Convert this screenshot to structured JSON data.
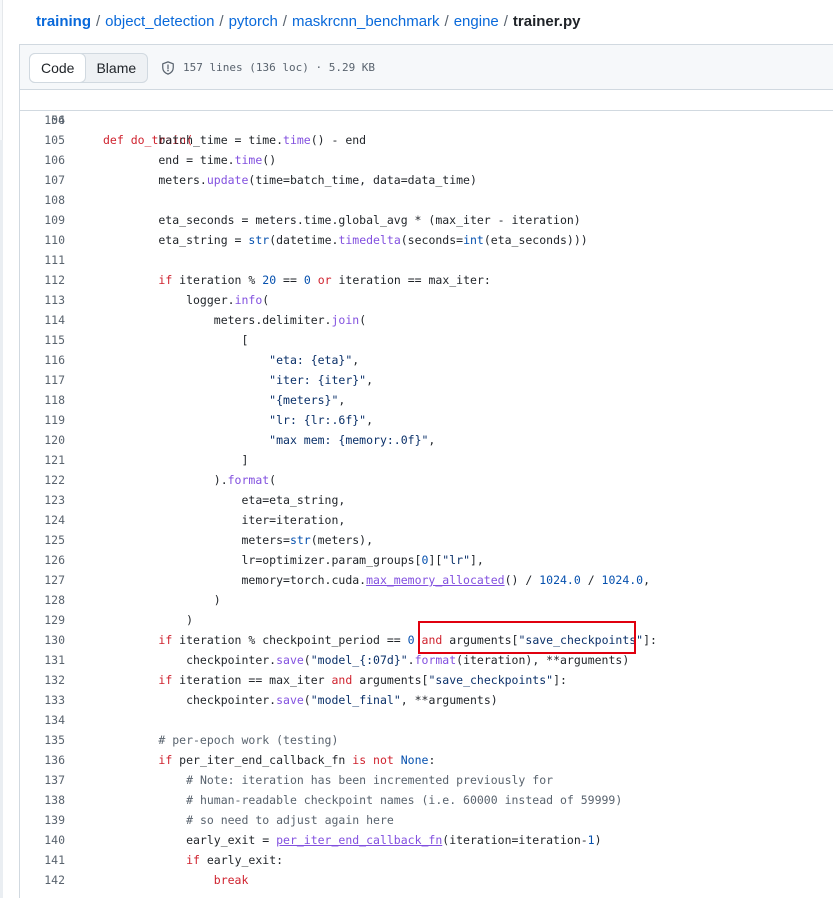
{
  "breadcrumb": {
    "parts": [
      "training",
      "object_detection",
      "pytorch",
      "maskrcnn_benchmark",
      "engine"
    ],
    "current": "trainer.py",
    "separator": "/"
  },
  "file_header": {
    "code_tab": "Code",
    "blame_tab": "Blame",
    "info": "157 lines (136 loc) · 5.29 KB"
  },
  "sticky": {
    "number": "56",
    "code": "def do_train("
  },
  "code_lines": [
    {
      "n": "104",
      "t": []
    },
    {
      "n": "105",
      "t": [
        [
          "        batch_time = time.",
          ""
        ],
        [
          "time",
          "fn"
        ],
        [
          "() - end",
          ""
        ]
      ]
    },
    {
      "n": "106",
      "t": [
        [
          "        end = time.",
          ""
        ],
        [
          "time",
          "fn"
        ],
        [
          "()",
          ""
        ]
      ]
    },
    {
      "n": "107",
      "t": [
        [
          "        meters.",
          ""
        ],
        [
          "update",
          "fn"
        ],
        [
          "(time=batch_time, data=data_time)",
          ""
        ]
      ]
    },
    {
      "n": "108",
      "t": []
    },
    {
      "n": "109",
      "t": [
        [
          "        eta_seconds = meters.time.global_avg * (max_iter - iteration)",
          ""
        ]
      ]
    },
    {
      "n": "110",
      "t": [
        [
          "        eta_string = ",
          ""
        ],
        [
          "str",
          "bi"
        ],
        [
          "(datetime.",
          ""
        ],
        [
          "timedelta",
          "fn"
        ],
        [
          "(seconds=",
          ""
        ],
        [
          "int",
          "bi"
        ],
        [
          "(eta_seconds)))",
          ""
        ]
      ]
    },
    {
      "n": "111",
      "t": []
    },
    {
      "n": "112",
      "t": [
        [
          "        ",
          ""
        ],
        [
          "if",
          "kw"
        ],
        [
          " iteration % ",
          ""
        ],
        [
          "20",
          "num"
        ],
        [
          " == ",
          ""
        ],
        [
          "0",
          "num"
        ],
        [
          " ",
          ""
        ],
        [
          "or",
          "kw"
        ],
        [
          " iteration == max_iter:",
          ""
        ]
      ]
    },
    {
      "n": "113",
      "t": [
        [
          "            logger.",
          ""
        ],
        [
          "info",
          "fn"
        ],
        [
          "(",
          ""
        ]
      ]
    },
    {
      "n": "114",
      "t": [
        [
          "                meters.delimiter.",
          ""
        ],
        [
          "join",
          "fn"
        ],
        [
          "(",
          ""
        ]
      ]
    },
    {
      "n": "115",
      "t": [
        [
          "                    [",
          ""
        ]
      ]
    },
    {
      "n": "116",
      "t": [
        [
          "                        ",
          ""
        ],
        [
          "\"eta: {eta}\"",
          "str"
        ],
        [
          ",",
          ""
        ]
      ]
    },
    {
      "n": "117",
      "t": [
        [
          "                        ",
          ""
        ],
        [
          "\"iter: {iter}\"",
          "str"
        ],
        [
          ",",
          ""
        ]
      ]
    },
    {
      "n": "118",
      "t": [
        [
          "                        ",
          ""
        ],
        [
          "\"{meters}\"",
          "str"
        ],
        [
          ",",
          ""
        ]
      ]
    },
    {
      "n": "119",
      "t": [
        [
          "                        ",
          ""
        ],
        [
          "\"lr: {lr:.6f}\"",
          "str"
        ],
        [
          ",",
          ""
        ]
      ]
    },
    {
      "n": "120",
      "t": [
        [
          "                        ",
          ""
        ],
        [
          "\"max mem: {memory:.0f}\"",
          "str"
        ],
        [
          ",",
          ""
        ]
      ]
    },
    {
      "n": "121",
      "t": [
        [
          "                    ]",
          ""
        ]
      ]
    },
    {
      "n": "122",
      "t": [
        [
          "                ).",
          ""
        ],
        [
          "format",
          "fn"
        ],
        [
          "(",
          ""
        ]
      ]
    },
    {
      "n": "123",
      "t": [
        [
          "                    eta=eta_string,",
          ""
        ]
      ]
    },
    {
      "n": "124",
      "t": [
        [
          "                    iter=iteration,",
          ""
        ]
      ]
    },
    {
      "n": "125",
      "t": [
        [
          "                    meters=",
          ""
        ],
        [
          "str",
          "bi"
        ],
        [
          "(meters),",
          ""
        ]
      ]
    },
    {
      "n": "126",
      "t": [
        [
          "                    lr=optimizer.param_groups[",
          ""
        ],
        [
          "0",
          "num"
        ],
        [
          "][",
          ""
        ],
        [
          "\"lr\"",
          "str"
        ],
        [
          "],",
          ""
        ]
      ]
    },
    {
      "n": "127",
      "t": [
        [
          "                    memory=torch.cuda.",
          ""
        ],
        [
          "max_memory_allocated",
          "fn ul"
        ],
        [
          "() / ",
          ""
        ],
        [
          "1024.0",
          "num"
        ],
        [
          " / ",
          ""
        ],
        [
          "1024.0",
          "num"
        ],
        [
          ",",
          ""
        ]
      ]
    },
    {
      "n": "128",
      "t": [
        [
          "                )",
          ""
        ]
      ]
    },
    {
      "n": "129",
      "t": [
        [
          "            )",
          ""
        ]
      ]
    },
    {
      "n": "130",
      "t": [
        [
          "        ",
          ""
        ],
        [
          "if",
          "kw"
        ],
        [
          " iteration % checkpoint_period == ",
          ""
        ],
        [
          "0",
          "num"
        ],
        [
          " ",
          ""
        ],
        [
          "and",
          "kw"
        ],
        [
          " arguments[",
          ""
        ],
        [
          "\"save_checkpoints\"",
          "str"
        ],
        [
          "]:",
          ""
        ]
      ]
    },
    {
      "n": "131",
      "t": [
        [
          "            checkpointer.",
          ""
        ],
        [
          "save",
          "fn"
        ],
        [
          "(",
          ""
        ],
        [
          "\"model_{:07d}\"",
          "str"
        ],
        [
          ".",
          ""
        ],
        [
          "format",
          "fn"
        ],
        [
          "(iteration), **arguments)",
          ""
        ]
      ]
    },
    {
      "n": "132",
      "t": [
        [
          "        ",
          ""
        ],
        [
          "if",
          "kw"
        ],
        [
          " iteration == max_iter ",
          ""
        ],
        [
          "and",
          "kw"
        ],
        [
          " arguments[",
          ""
        ],
        [
          "\"save_checkpoints\"",
          "str"
        ],
        [
          "]:",
          ""
        ]
      ]
    },
    {
      "n": "133",
      "t": [
        [
          "            checkpointer.",
          ""
        ],
        [
          "save",
          "fn"
        ],
        [
          "(",
          ""
        ],
        [
          "\"model_final\"",
          "str"
        ],
        [
          ", **arguments)",
          ""
        ]
      ]
    },
    {
      "n": "134",
      "t": []
    },
    {
      "n": "135",
      "t": [
        [
          "        ",
          ""
        ],
        [
          "# per-epoch work (testing)",
          "cm"
        ]
      ]
    },
    {
      "n": "136",
      "t": [
        [
          "        ",
          ""
        ],
        [
          "if",
          "kw"
        ],
        [
          " per_iter_end_callback_fn ",
          ""
        ],
        [
          "is not",
          "kw"
        ],
        [
          " ",
          ""
        ],
        [
          "None",
          "bi"
        ],
        [
          ":",
          ""
        ]
      ]
    },
    {
      "n": "137",
      "t": [
        [
          "            ",
          ""
        ],
        [
          "# Note: iteration has been incremented previously for",
          "cm"
        ]
      ]
    },
    {
      "n": "138",
      "t": [
        [
          "            ",
          ""
        ],
        [
          "# human-readable checkpoint names (i.e. 60000 instead of 59999)",
          "cm"
        ]
      ]
    },
    {
      "n": "139",
      "t": [
        [
          "            ",
          ""
        ],
        [
          "# so need to adjust again here",
          "cm"
        ]
      ]
    },
    {
      "n": "140",
      "t": [
        [
          "            early_exit = ",
          ""
        ],
        [
          "per_iter_end_callback_fn",
          "fn ul"
        ],
        [
          "(iteration=iteration-",
          ""
        ],
        [
          "1",
          "num"
        ],
        [
          ")",
          ""
        ]
      ]
    },
    {
      "n": "141",
      "t": [
        [
          "            ",
          ""
        ],
        [
          "if",
          "kw"
        ],
        [
          " early_exit:",
          ""
        ]
      ]
    },
    {
      "n": "142",
      "t": [
        [
          "                ",
          ""
        ],
        [
          "break",
          "kw"
        ]
      ]
    }
  ],
  "colors": {
    "link": "#0969da",
    "keyword": "#cf222e",
    "function": "#8250df",
    "string": "#0a3069",
    "number": "#0550ae",
    "comment": "#59636e",
    "annotation_box": "#e0000f"
  },
  "icons": {
    "file_info": "shield-icon"
  }
}
